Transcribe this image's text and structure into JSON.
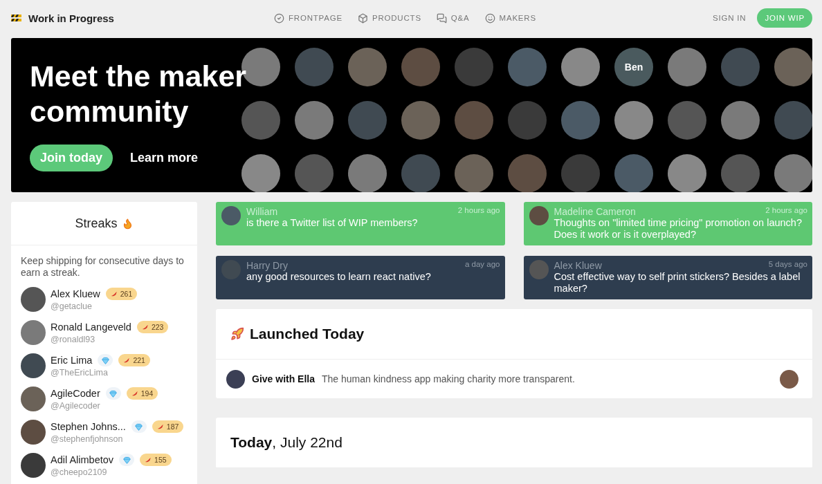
{
  "header": {
    "brand": "Work in Progress",
    "nav": [
      {
        "label": "FRONTPAGE"
      },
      {
        "label": "PRODUCTS"
      },
      {
        "label": "Q&A"
      },
      {
        "label": "MAKERS"
      }
    ],
    "sign_in": "SIGN IN",
    "join": "JOIN WIP"
  },
  "hero": {
    "title_lines": [
      "Meet the maker",
      "community"
    ],
    "primary_button": "Join today",
    "secondary_button": "Learn more",
    "named_avatar": {
      "label": "Ben"
    }
  },
  "streaks": {
    "title": "Streaks",
    "intro": "Keep shipping for consecutive days to earn a streak.",
    "makers": [
      {
        "name": "Alex Kluew",
        "handle": "@getaclue",
        "patron": false,
        "streak": "261"
      },
      {
        "name": "Ronald Langeveld",
        "handle": "@ronaldl93",
        "patron": false,
        "streak": "223"
      },
      {
        "name": "Eric Lima",
        "handle": "@TheEricLima",
        "patron": true,
        "streak": "221"
      },
      {
        "name": "AgileCoder",
        "handle": "@Agilecoder",
        "patron": true,
        "streak": "194"
      },
      {
        "name": "Stephen Johns...",
        "handle": "@stephenfjohnson",
        "patron": true,
        "streak": "187"
      },
      {
        "name": "Adil Alimbetov",
        "handle": "@cheepo2109",
        "patron": true,
        "streak": "155"
      }
    ]
  },
  "questions": [
    {
      "author": "William",
      "time": "2 hours ago",
      "text": "is there a Twitter list of WIP members?",
      "kind": "open"
    },
    {
      "author": "Madeline Cameron",
      "time": "2 hours ago",
      "text": "Thoughts on \"limited time pricing\" promotion on launch? Does it work or is it overplayed?",
      "kind": "open"
    },
    {
      "author": "Harry Dry",
      "time": "a day ago",
      "text": "any good resources to learn react native?",
      "kind": "dark"
    },
    {
      "author": "Alex Kluew",
      "time": "5 days ago",
      "text": "Cost effective way to self print stickers? Besides a label maker?",
      "kind": "dark"
    }
  ],
  "launched": {
    "title": "Launched Today",
    "products": [
      {
        "name": "Give with Ella",
        "tagline": "The human kindness app making charity more transparent."
      }
    ]
  },
  "today": {
    "title": "**Today**, July 22nd"
  }
}
